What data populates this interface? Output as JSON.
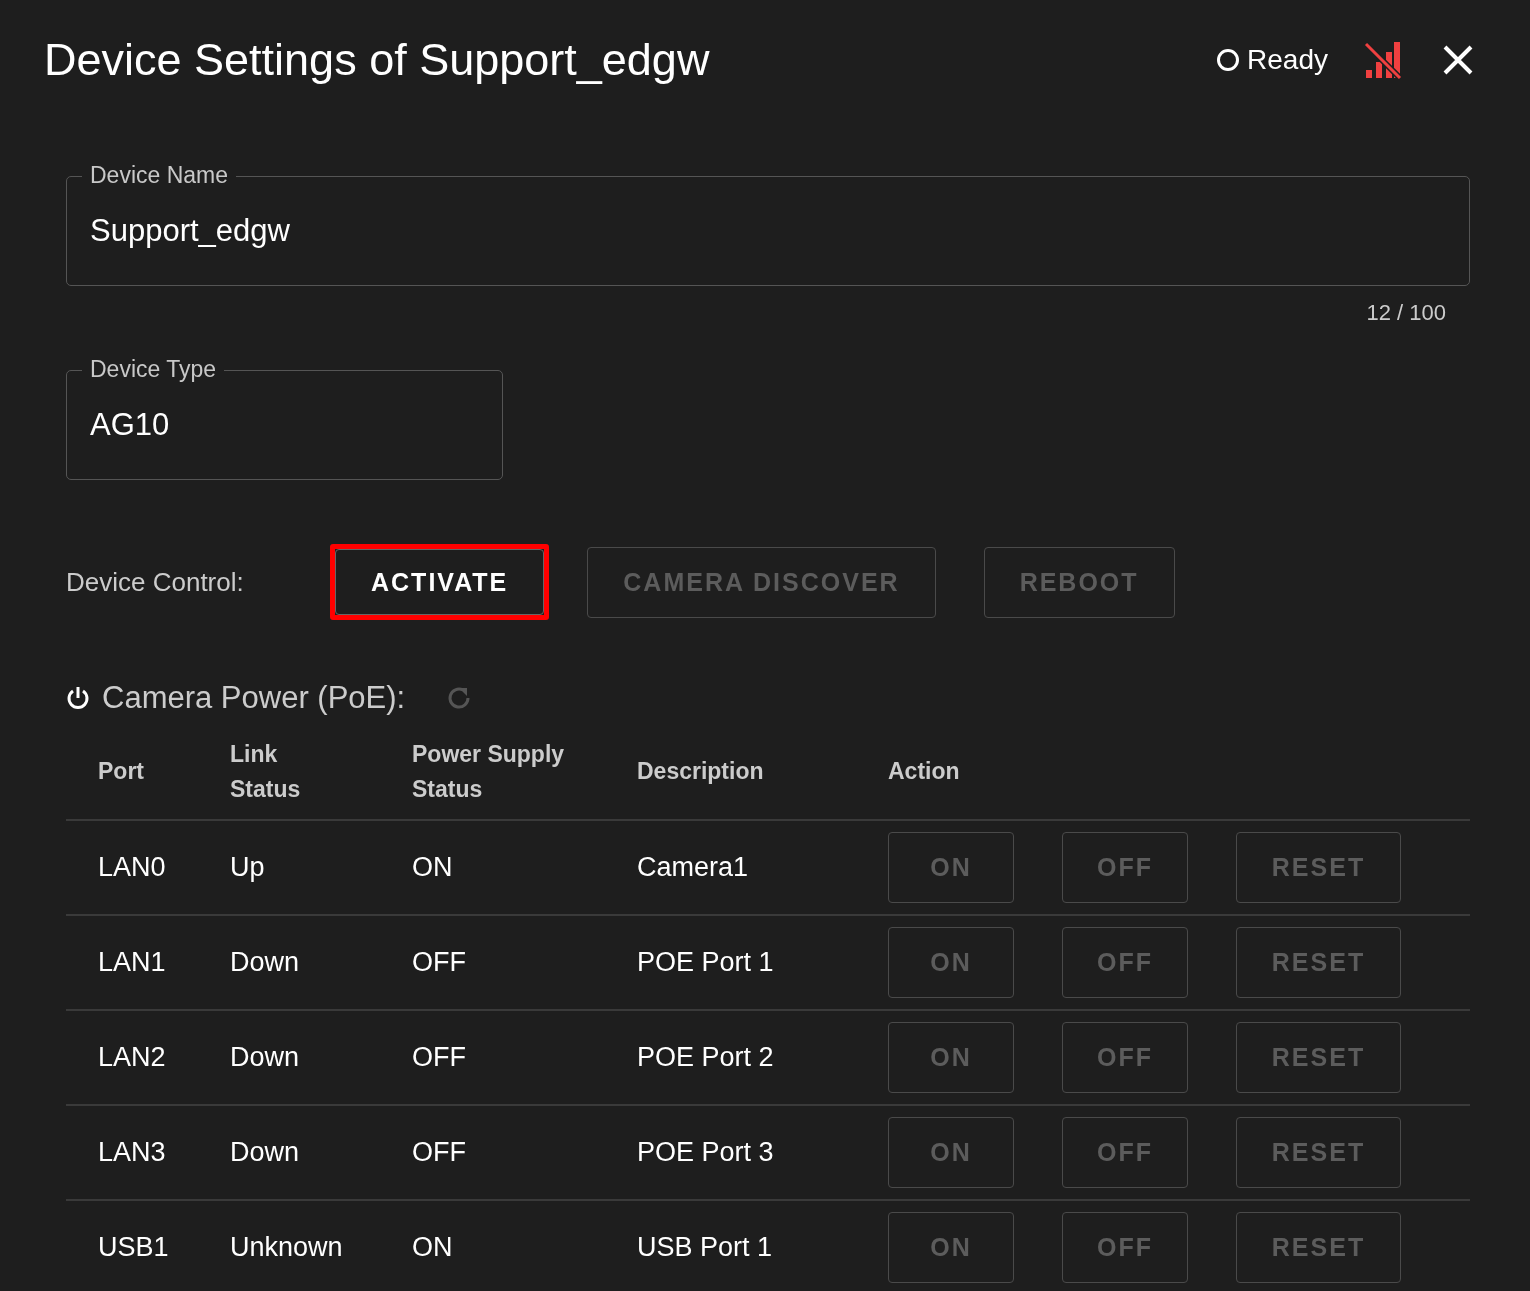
{
  "dialog": {
    "title": "Device Settings of Support_edgw",
    "status": {
      "label": "Ready",
      "connected": false
    }
  },
  "fields": [
    {
      "label": "Device Name",
      "value": "Support_edgw",
      "counter": "12 / 100"
    },
    {
      "label": "Device Type",
      "value": "AG10"
    }
  ],
  "device_control": {
    "label": "Device Control:",
    "buttons": [
      {
        "label": "ACTIVATE",
        "disabled": false,
        "highlighted": true
      },
      {
        "label": "CAMERA DISCOVER",
        "disabled": true,
        "highlighted": false
      },
      {
        "label": "REBOOT",
        "disabled": true,
        "highlighted": false
      }
    ]
  },
  "poe": {
    "title": "Camera Power (PoE):",
    "columns": [
      "Port",
      "Link Status",
      "Power Supply Status",
      "Description",
      "Action"
    ],
    "rows": [
      {
        "port": "LAN0",
        "link_status": "Up",
        "power_status": "ON",
        "description": "Camera1",
        "actions": [
          {
            "label": "ON",
            "disabled": true
          },
          {
            "label": "OFF",
            "disabled": true
          },
          {
            "label": "RESET",
            "disabled": true
          }
        ]
      },
      {
        "port": "LAN1",
        "link_status": "Down",
        "power_status": "OFF",
        "description": "POE Port 1",
        "actions": [
          {
            "label": "ON",
            "disabled": true
          },
          {
            "label": "OFF",
            "disabled": true
          },
          {
            "label": "RESET",
            "disabled": true
          }
        ]
      },
      {
        "port": "LAN2",
        "link_status": "Down",
        "power_status": "OFF",
        "description": "POE Port 2",
        "actions": [
          {
            "label": "ON",
            "disabled": true
          },
          {
            "label": "OFF",
            "disabled": true
          },
          {
            "label": "RESET",
            "disabled": true
          }
        ]
      },
      {
        "port": "LAN3",
        "link_status": "Down",
        "power_status": "OFF",
        "description": "POE Port 3",
        "actions": [
          {
            "label": "ON",
            "disabled": true
          },
          {
            "label": "OFF",
            "disabled": true
          },
          {
            "label": "RESET",
            "disabled": true
          }
        ]
      },
      {
        "port": "USB1",
        "link_status": "Unknown",
        "power_status": "ON",
        "description": "USB Port 1",
        "actions": [
          {
            "label": "ON",
            "disabled": true
          },
          {
            "label": "OFF",
            "disabled": true
          },
          {
            "label": "RESET",
            "disabled": true
          }
        ]
      }
    ]
  }
}
